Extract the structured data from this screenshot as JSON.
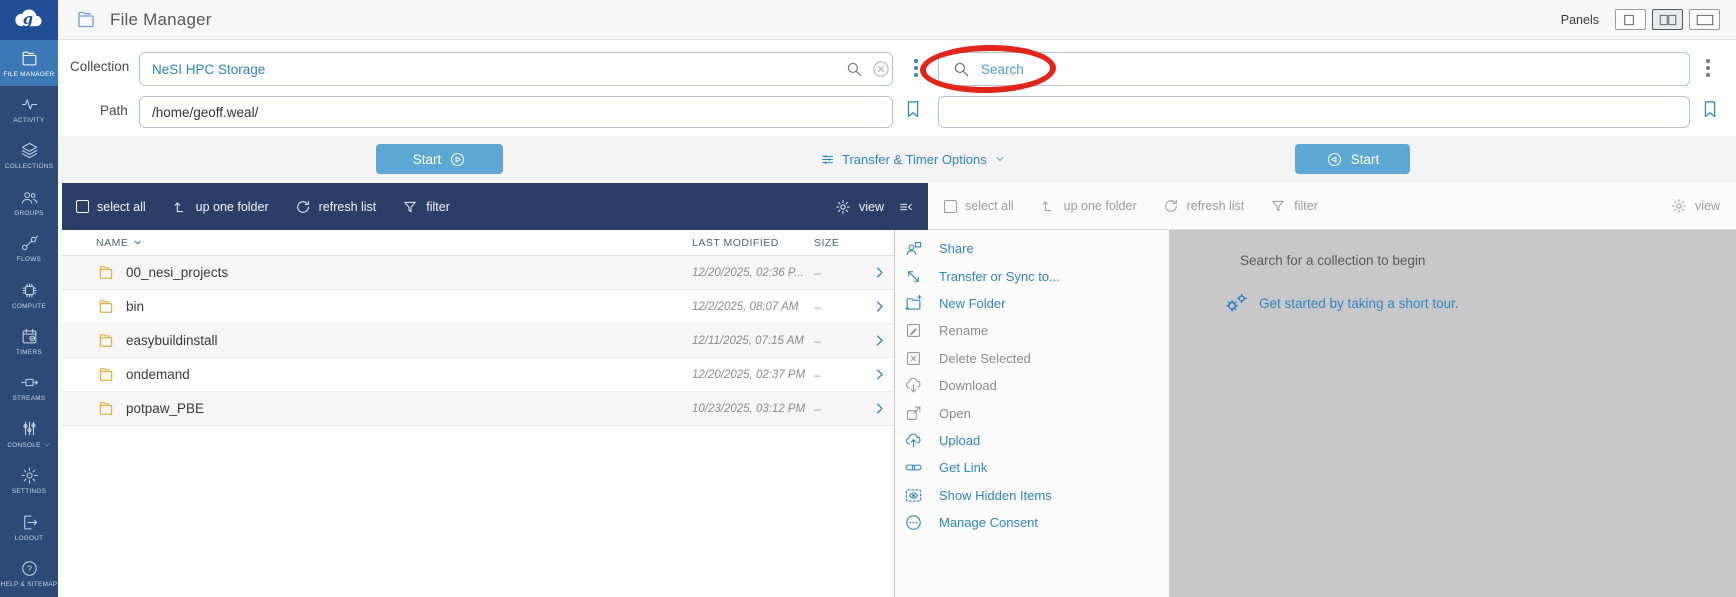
{
  "app": {
    "title": "File Manager",
    "logo_letter": "g"
  },
  "header": {
    "panels_label": "Panels"
  },
  "sidebar": {
    "items": [
      {
        "label": "FILE MANAGER",
        "active": true
      },
      {
        "label": "ACTIVITY"
      },
      {
        "label": "COLLECTIONS"
      },
      {
        "label": "GROUPS"
      },
      {
        "label": "FLOWS"
      },
      {
        "label": "COMPUTE"
      },
      {
        "label": "TIMERS"
      },
      {
        "label": "STREAMS"
      },
      {
        "label": "CONSOLE"
      },
      {
        "label": "SETTINGS"
      },
      {
        "label": "LOGOUT"
      },
      {
        "label": "HELP & SITEMAP"
      }
    ]
  },
  "io": {
    "collection_label": "Collection",
    "collection_value": "NeSI HPC Storage",
    "path_label": "Path",
    "path_value": "/home/geoff.weal/",
    "search_placeholder": "Search"
  },
  "transfer": {
    "start_left_label": "Start",
    "options_label": "Transfer & Timer Options",
    "start_right_label": "Start"
  },
  "toolbar": {
    "select_all": "select all",
    "up_one_folder": "up one folder",
    "refresh_list": "refresh list",
    "filter": "filter",
    "view": "view"
  },
  "file_list": {
    "columns": {
      "name": "NAME",
      "modified": "LAST MODIFIED",
      "size": "SIZE"
    },
    "rows": [
      {
        "name": "00_nesi_projects",
        "modified": "12/20/2025, 02:36 P...",
        "size": "–"
      },
      {
        "name": "bin",
        "modified": "12/2/2025, 08:07 AM",
        "size": "–"
      },
      {
        "name": "easybuildinstall",
        "modified": "12/11/2025, 07:15 AM",
        "size": "–"
      },
      {
        "name": "ondemand",
        "modified": "12/20/2025, 02:37 PM",
        "size": "–"
      },
      {
        "name": "potpaw_PBE",
        "modified": "10/23/2025, 03:12 PM",
        "size": "–"
      }
    ]
  },
  "action_menu": {
    "items": [
      {
        "label": "Share",
        "enabled": true
      },
      {
        "label": "Transfer or Sync to...",
        "enabled": true
      },
      {
        "label": "New Folder",
        "enabled": true
      },
      {
        "label": "Rename",
        "enabled": false
      },
      {
        "label": "Delete Selected",
        "enabled": false
      },
      {
        "label": "Download",
        "enabled": false
      },
      {
        "label": "Open",
        "enabled": false
      },
      {
        "label": "Upload",
        "enabled": true
      },
      {
        "label": "Get Link",
        "enabled": true
      },
      {
        "label": "Show Hidden Items",
        "enabled": true
      },
      {
        "label": "Manage Consent",
        "enabled": true
      }
    ]
  },
  "right_panel": {
    "empty_title": "Search for a collection to begin",
    "tour_link": "Get started by taking a short tour."
  },
  "colors": {
    "accent_blue": "#2e86c1",
    "sidebar_navy": "#2d4a77",
    "active_item_blue": "#3c77b6",
    "toolbar_navy": "#2c3e68",
    "start_button_blue": "#5da7d3",
    "annotation_red": "#e2251b",
    "panel_gray": "#c8c8c8",
    "folder_yellow": "#e3a72f"
  }
}
